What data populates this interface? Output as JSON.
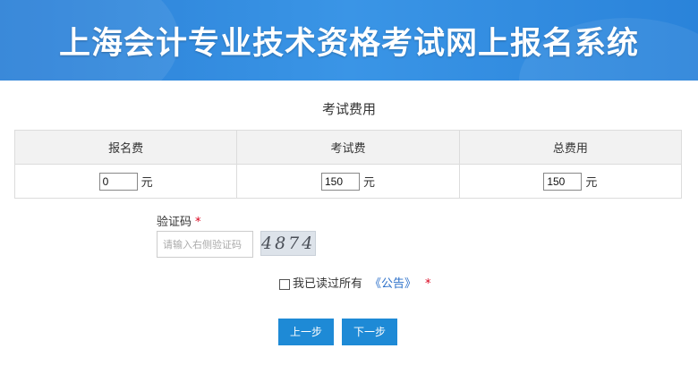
{
  "header": {
    "title": "上海会计专业技术资格考试网上报名系统"
  },
  "fees": {
    "section_title": "考试费用",
    "columns": [
      "报名费",
      "考试费",
      "总费用"
    ],
    "values": [
      "0",
      "150",
      "150"
    ],
    "unit": "元"
  },
  "captcha": {
    "label": "验证码",
    "required_mark": "*",
    "placeholder": "请输入右侧验证码",
    "code": "4874"
  },
  "agreement": {
    "text": "我已读过所有",
    "link_text": "《公告》",
    "required_mark": "*"
  },
  "buttons": {
    "prev": "上一步",
    "next": "下一步"
  },
  "colors": {
    "banner": "#2a7fd6",
    "button": "#1e8ad6",
    "required": "#d9001b",
    "link": "#2a6fc9"
  }
}
